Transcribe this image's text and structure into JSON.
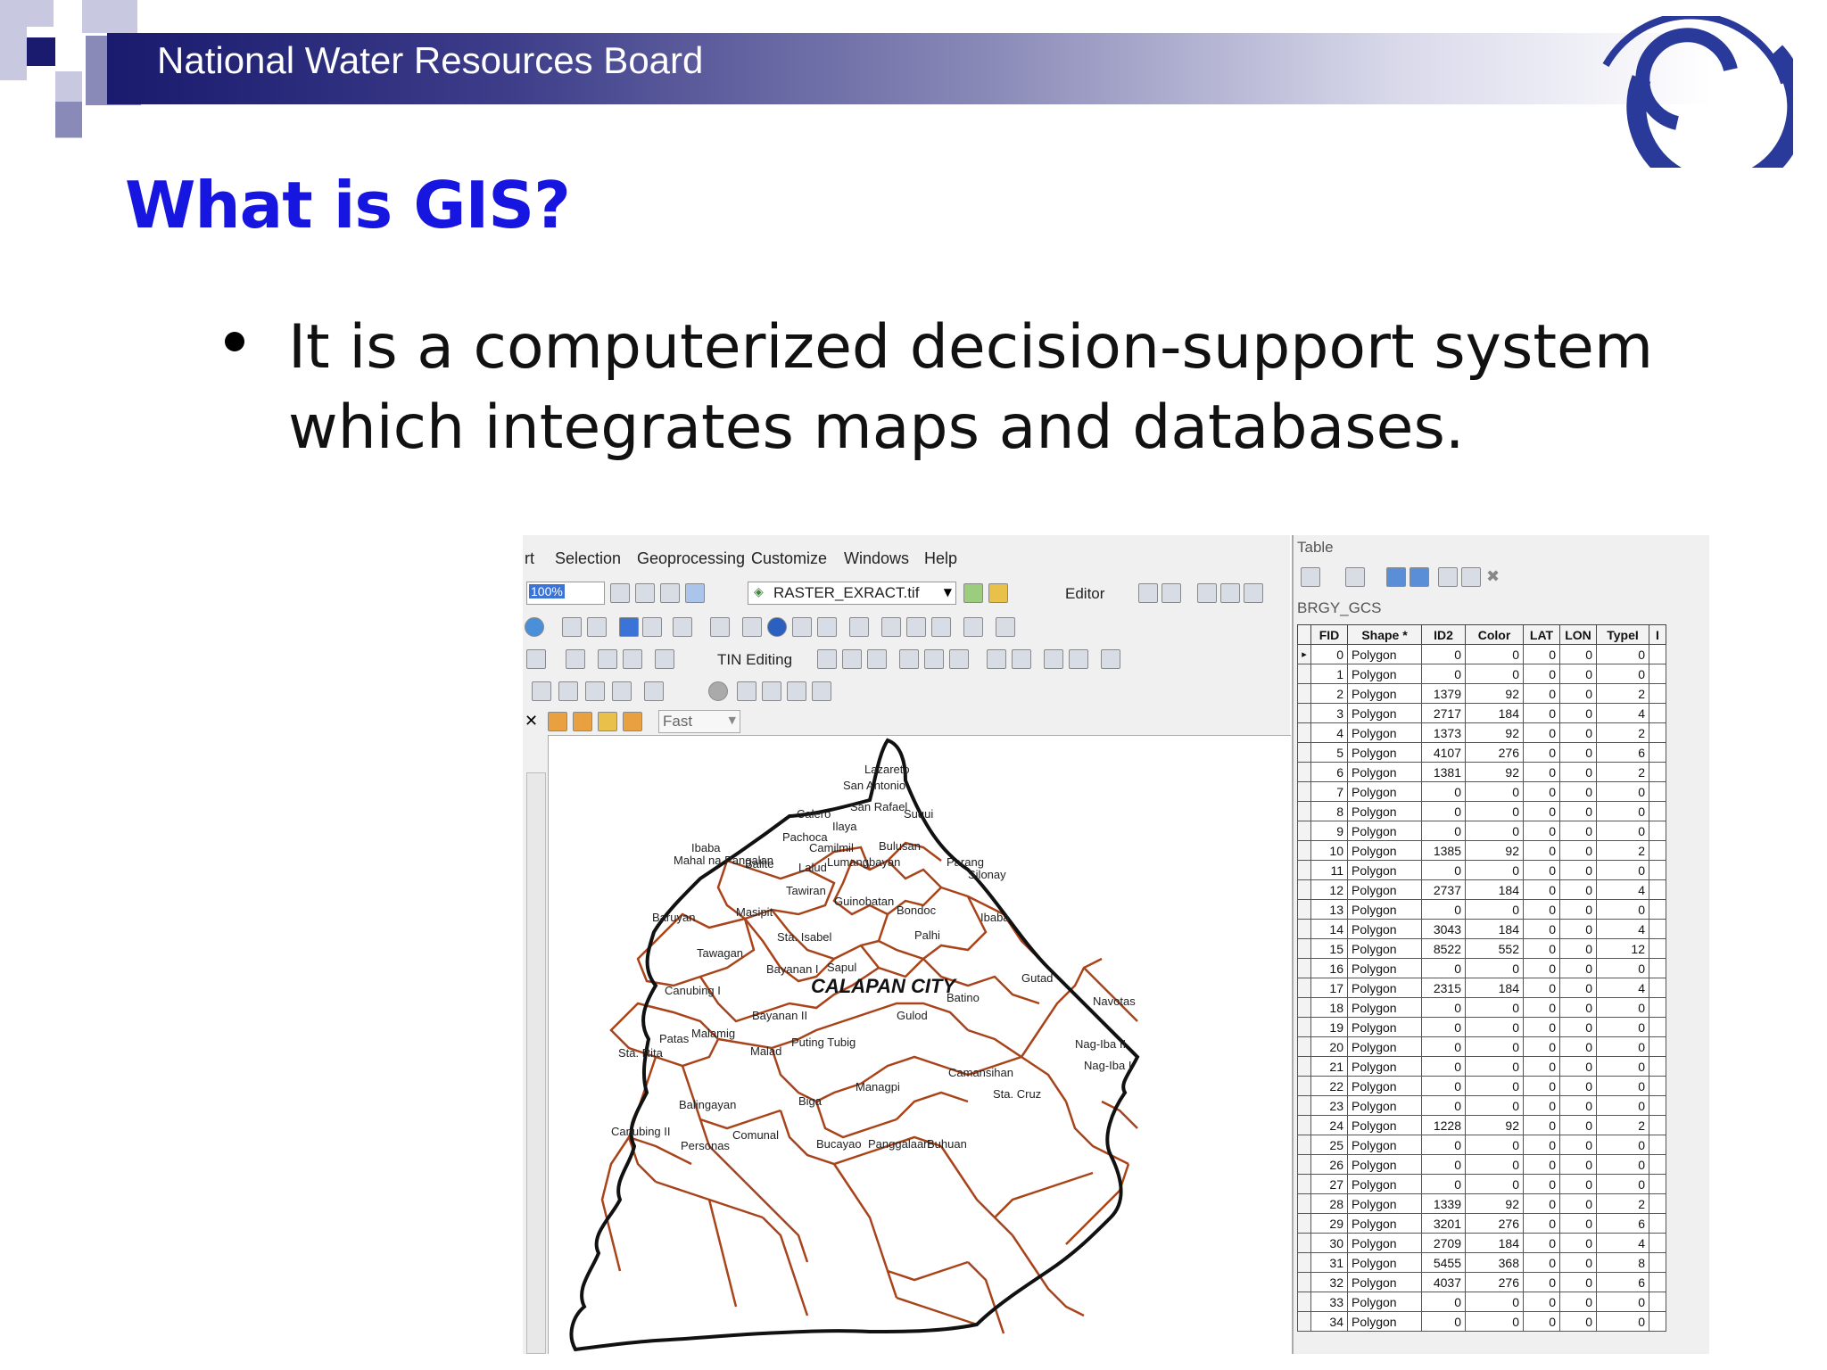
{
  "header": {
    "org_name": "National Water Resources Board",
    "banner_color": "#1a1a6e",
    "logo_icon": "nwrb-swirl-logo"
  },
  "slide": {
    "title": "What is GIS?",
    "title_color": "#1616e0",
    "bullet": {
      "line1": "It is a computerized decision-support system",
      "line2": "which integrates maps and databases."
    }
  },
  "arcmap": {
    "menu": [
      "rt",
      "Selection",
      "Geoprocessing",
      "Customize",
      "Windows",
      "Help"
    ],
    "toolbar": {
      "scale_value": "100%",
      "layer_select": "RASTER_EXRACT.tif",
      "editor_label": "Editor",
      "tin_editing_label": "TIN Editing",
      "quality_select": "Fast"
    },
    "map": {
      "city_label": "CALAPAN CITY",
      "barangays": [
        "Lazareto",
        "San Antonio",
        "San Rafael",
        "Suqui",
        "Calero",
        "Ilaya",
        "Pachoca",
        "Ibaba",
        "Mahal na Pangalan",
        "Balite",
        "Lalud",
        "Camilmil",
        "Lumangbayan",
        "Bulusan",
        "Parang",
        "Silonay",
        "Tawiran",
        "Guinobatan",
        "Bondoc",
        "Baruyan",
        "Masipit",
        "Sta. Isabel",
        "Palhi",
        "Ibaba",
        "Tawagan",
        "Bayanan I",
        "Sapul",
        "Gutad",
        "Canubing I",
        "Bayanan II",
        "Gulod",
        "Batino",
        "Navotas",
        "Patas",
        "Malamig",
        "Malad",
        "Puting Tubig",
        "Nag-Iba II",
        "Nag-Iba I",
        "Sta. Rita",
        "Camansihan",
        "Managpi",
        "Balingayan",
        "Biga",
        "Sta. Cruz",
        "Canubing II",
        "Personas",
        "Comunal",
        "Bucayao",
        "Panggalaan",
        "Buhuan"
      ]
    },
    "table": {
      "panel_title": "Table",
      "layer_name": "BRGY_GCS",
      "columns": [
        "FID",
        "Shape *",
        "ID2",
        "Color",
        "LAT",
        "LON",
        "TypeI",
        "I"
      ],
      "rows": [
        [
          0,
          "Polygon",
          0,
          0,
          0,
          0,
          0
        ],
        [
          1,
          "Polygon",
          0,
          0,
          0,
          0,
          0
        ],
        [
          2,
          "Polygon",
          1379,
          92,
          0,
          0,
          2
        ],
        [
          3,
          "Polygon",
          2717,
          184,
          0,
          0,
          4
        ],
        [
          4,
          "Polygon",
          1373,
          92,
          0,
          0,
          2
        ],
        [
          5,
          "Polygon",
          4107,
          276,
          0,
          0,
          6
        ],
        [
          6,
          "Polygon",
          1381,
          92,
          0,
          0,
          2
        ],
        [
          7,
          "Polygon",
          0,
          0,
          0,
          0,
          0
        ],
        [
          8,
          "Polygon",
          0,
          0,
          0,
          0,
          0
        ],
        [
          9,
          "Polygon",
          0,
          0,
          0,
          0,
          0
        ],
        [
          10,
          "Polygon",
          1385,
          92,
          0,
          0,
          2
        ],
        [
          11,
          "Polygon",
          0,
          0,
          0,
          0,
          0
        ],
        [
          12,
          "Polygon",
          2737,
          184,
          0,
          0,
          4
        ],
        [
          13,
          "Polygon",
          0,
          0,
          0,
          0,
          0
        ],
        [
          14,
          "Polygon",
          3043,
          184,
          0,
          0,
          4
        ],
        [
          15,
          "Polygon",
          8522,
          552,
          0,
          0,
          12
        ],
        [
          16,
          "Polygon",
          0,
          0,
          0,
          0,
          0
        ],
        [
          17,
          "Polygon",
          2315,
          184,
          0,
          0,
          4
        ],
        [
          18,
          "Polygon",
          0,
          0,
          0,
          0,
          0
        ],
        [
          19,
          "Polygon",
          0,
          0,
          0,
          0,
          0
        ],
        [
          20,
          "Polygon",
          0,
          0,
          0,
          0,
          0
        ],
        [
          21,
          "Polygon",
          0,
          0,
          0,
          0,
          0
        ],
        [
          22,
          "Polygon",
          0,
          0,
          0,
          0,
          0
        ],
        [
          23,
          "Polygon",
          0,
          0,
          0,
          0,
          0
        ],
        [
          24,
          "Polygon",
          1228,
          92,
          0,
          0,
          2
        ],
        [
          25,
          "Polygon",
          0,
          0,
          0,
          0,
          0
        ],
        [
          26,
          "Polygon",
          0,
          0,
          0,
          0,
          0
        ],
        [
          27,
          "Polygon",
          0,
          0,
          0,
          0,
          0
        ],
        [
          28,
          "Polygon",
          1339,
          92,
          0,
          0,
          2
        ],
        [
          29,
          "Polygon",
          3201,
          276,
          0,
          0,
          6
        ],
        [
          30,
          "Polygon",
          2709,
          184,
          0,
          0,
          4
        ],
        [
          31,
          "Polygon",
          5455,
          368,
          0,
          0,
          8
        ],
        [
          32,
          "Polygon",
          4037,
          276,
          0,
          0,
          6
        ],
        [
          33,
          "Polygon",
          0,
          0,
          0,
          0,
          0
        ],
        [
          34,
          "Polygon",
          0,
          0,
          0,
          0,
          0
        ]
      ]
    }
  }
}
